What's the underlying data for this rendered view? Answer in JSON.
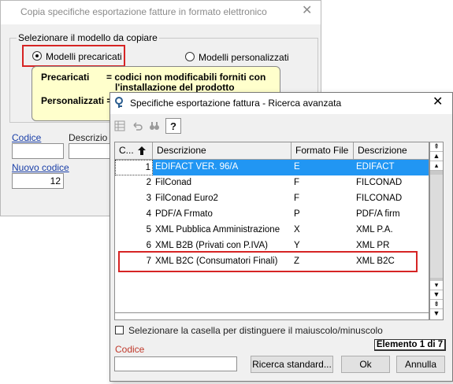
{
  "bg_dialog": {
    "title": "Copia specifiche esportazione fatture in formato elettronico",
    "close_symbol": "✕",
    "group_label": "Selezionare il modello da copiare",
    "radio_precaricati": "Modelli precaricati",
    "radio_personalizzati": "Modelli personalizzati",
    "info_line1_key": "Precaricati",
    "info_line1_val": "= codici non modificabili forniti con",
    "info_line2": "l'installazione del prodotto",
    "info_line3_key": "Personalizzati =",
    "codice_label": "Codice",
    "descrizione_label": "Descrizio",
    "nuovo_codice_label": "Nuovo codice",
    "nuovo_codice_value": "12"
  },
  "fg_dialog": {
    "title": "Specifiche esportazione fattura - Ricerca avanzata",
    "close_symbol": "✕",
    "toolbar": [
      "grid-icon",
      "undo-icon",
      "binoculars-icon",
      "help-icon"
    ],
    "help_label": "?",
    "columns": [
      "C...",
      "Descrizione",
      "Formato File",
      "Descrizione"
    ],
    "rows": [
      {
        "code": "1",
        "desc": "EDIFACT VER. 96/A",
        "format": "E",
        "desc2": "EDIFACT"
      },
      {
        "code": "2",
        "desc": "FilConad",
        "format": "F",
        "desc2": "FILCONAD"
      },
      {
        "code": "3",
        "desc": "FilConad Euro2",
        "format": "F",
        "desc2": "FILCONAD"
      },
      {
        "code": "4",
        "desc": "PDF/A Frmato",
        "format": "P",
        "desc2": "PDF/A firm"
      },
      {
        "code": "5",
        "desc": "XML Pubblica Amministrazione",
        "format": "X",
        "desc2": "XML P.A."
      },
      {
        "code": "6",
        "desc": "XML B2B (Privati con P.IVA)",
        "format": "Y",
        "desc2": "XML PR"
      },
      {
        "code": "7",
        "desc": "XML B2C (Consumatori Finali)",
        "format": "Z",
        "desc2": "XML B2C"
      }
    ],
    "selected_row": 0,
    "checkbox_label": "Selezionare la casella per distinguere il maiuscolo/minuscolo",
    "codice_label": "Codice",
    "codice_value": "",
    "btn_ricerca": "Ricerca standard...",
    "btn_ok": "Ok",
    "btn_annulla": "Annulla",
    "status": "Elemento 1 di 7"
  },
  "colors": {
    "selection": "#2196f3",
    "highlight_border": "#d62424",
    "info_bg": "#ffffcc",
    "link": "#1a3fa8",
    "codice_red": "#c0392b"
  }
}
